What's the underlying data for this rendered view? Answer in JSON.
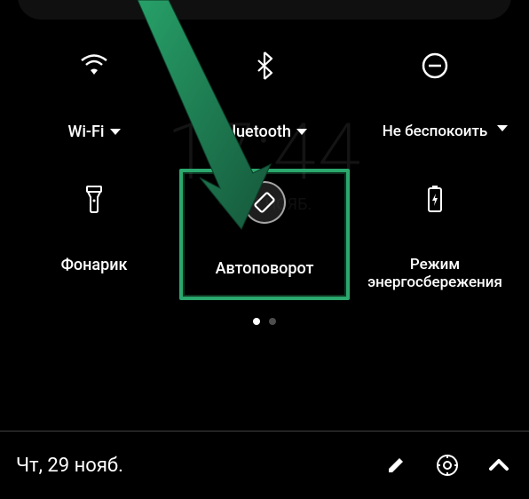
{
  "background": {
    "clock_time": "17:44",
    "clock_date": "ЧТ, 29 НОЯБ."
  },
  "tiles": [
    {
      "label": "Wi-Fi",
      "icon": "wifi-icon",
      "expandable": true
    },
    {
      "label": "Bluetooth",
      "icon": "bluetooth-icon",
      "expandable": true
    },
    {
      "label": "Не беспокоить",
      "icon": "dnd-icon",
      "expandable": true
    },
    {
      "label": "Фонарик",
      "icon": "flashlight-icon",
      "expandable": false
    },
    {
      "label": "Автоповорот",
      "icon": "autorotate-icon",
      "expandable": false,
      "highlighted": true,
      "circled": true
    },
    {
      "label": "Режим энергосбережения",
      "icon": "battery-saver-icon",
      "expandable": false
    }
  ],
  "pagination": {
    "current": 1,
    "total": 2
  },
  "bottom_bar": {
    "date": "Чт, 29 нояб."
  },
  "colors": {
    "highlight": "#2ba86d",
    "arrow": "#1f8f5a"
  }
}
